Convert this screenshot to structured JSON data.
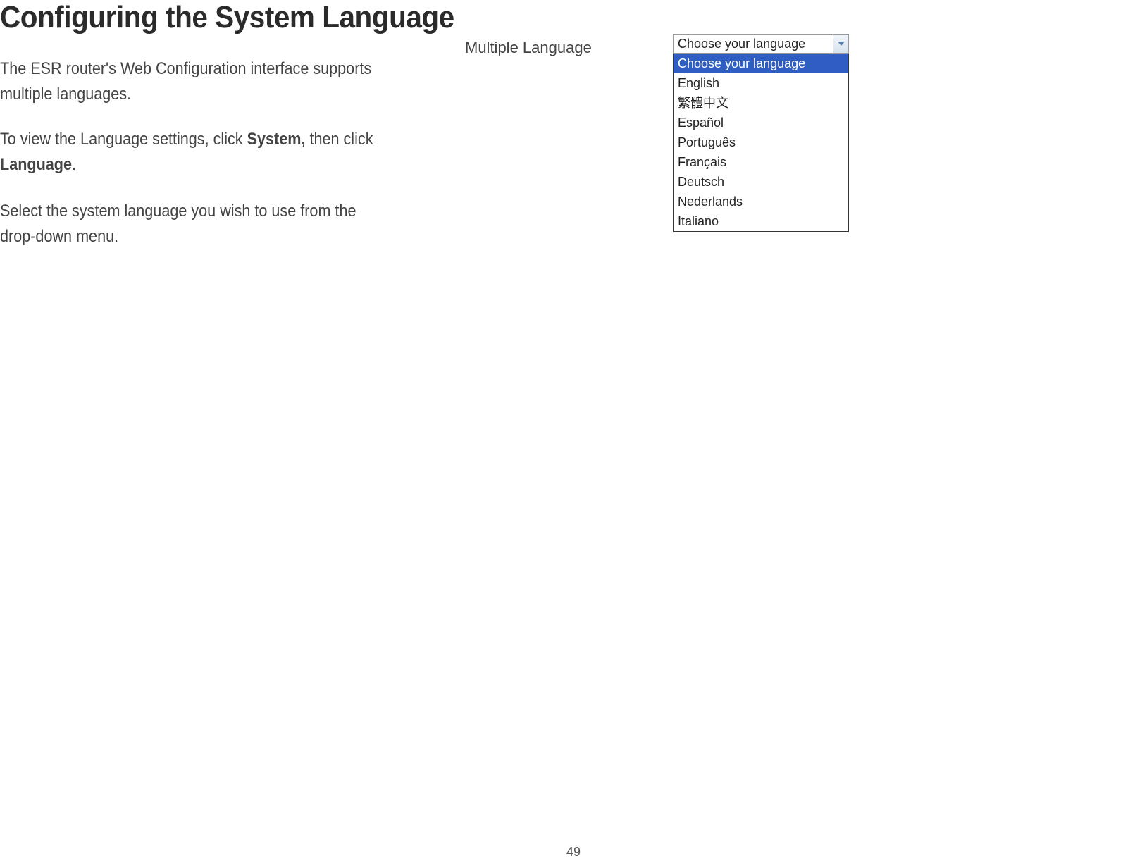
{
  "heading": "Configuring the System Language",
  "paragraphs": {
    "p1": "The ESR router's Web Configuration interface supports multiple languages.",
    "p2_a": "To view the Language settings, click ",
    "p2_b1": "System,",
    "p2_c": " then click ",
    "p2_b2": "Language",
    "p2_d": ".",
    "p3": "Select the system language you wish to use from the drop-down menu."
  },
  "dropdown": {
    "label": "Multiple Language",
    "selected": "Choose your language",
    "options": [
      "Choose your language",
      "English",
      "繁體中文",
      "Español",
      "Português",
      "Français",
      "Deutsch",
      "Nederlands",
      "Italiano"
    ],
    "highlighted_index": 0
  },
  "page_number": "49"
}
